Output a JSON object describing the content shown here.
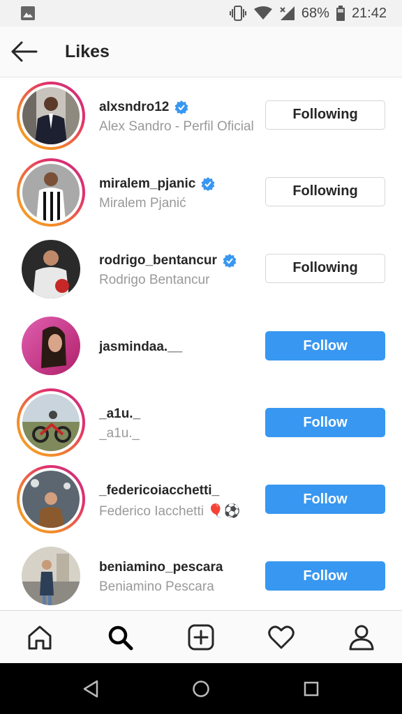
{
  "status_bar": {
    "battery": "68%",
    "time": "21:42"
  },
  "header": {
    "title": "Likes"
  },
  "users": [
    {
      "username": "alxsndro12",
      "full_name": "Alex Sandro - Perfil Oficial",
      "verified": true,
      "button": "Following"
    },
    {
      "username": "miralem_pjanic",
      "full_name": "Miralem Pjanić",
      "verified": true,
      "button": "Following"
    },
    {
      "username": "rodrigo_bentancur",
      "full_name": "Rodrigo Bentancur",
      "verified": true,
      "button": "Following"
    },
    {
      "username": "jasmindaa.__",
      "full_name": "",
      "verified": false,
      "button": "Follow"
    },
    {
      "username": "_a1u._",
      "full_name": "_a1u._",
      "verified": false,
      "button": "Follow"
    },
    {
      "username": "_federicoiacchetti_",
      "full_name": "Federico Iacchetti 🎈⚽",
      "verified": false,
      "button": "Follow"
    },
    {
      "username": "beniamino_pescara",
      "full_name": "Beniamino Pescara",
      "verified": false,
      "button": "Follow"
    }
  ],
  "colors": {
    "follow_blue": "#3897f0",
    "verified_blue": "#3897f0",
    "text_dark": "#262626",
    "text_gray": "#999999"
  },
  "bottom_nav": [
    "home-icon",
    "search-icon",
    "add-post-icon",
    "heart-icon",
    "profile-icon"
  ],
  "system_nav": [
    "back-triangle-icon",
    "home-circle-icon",
    "recents-square-icon"
  ]
}
